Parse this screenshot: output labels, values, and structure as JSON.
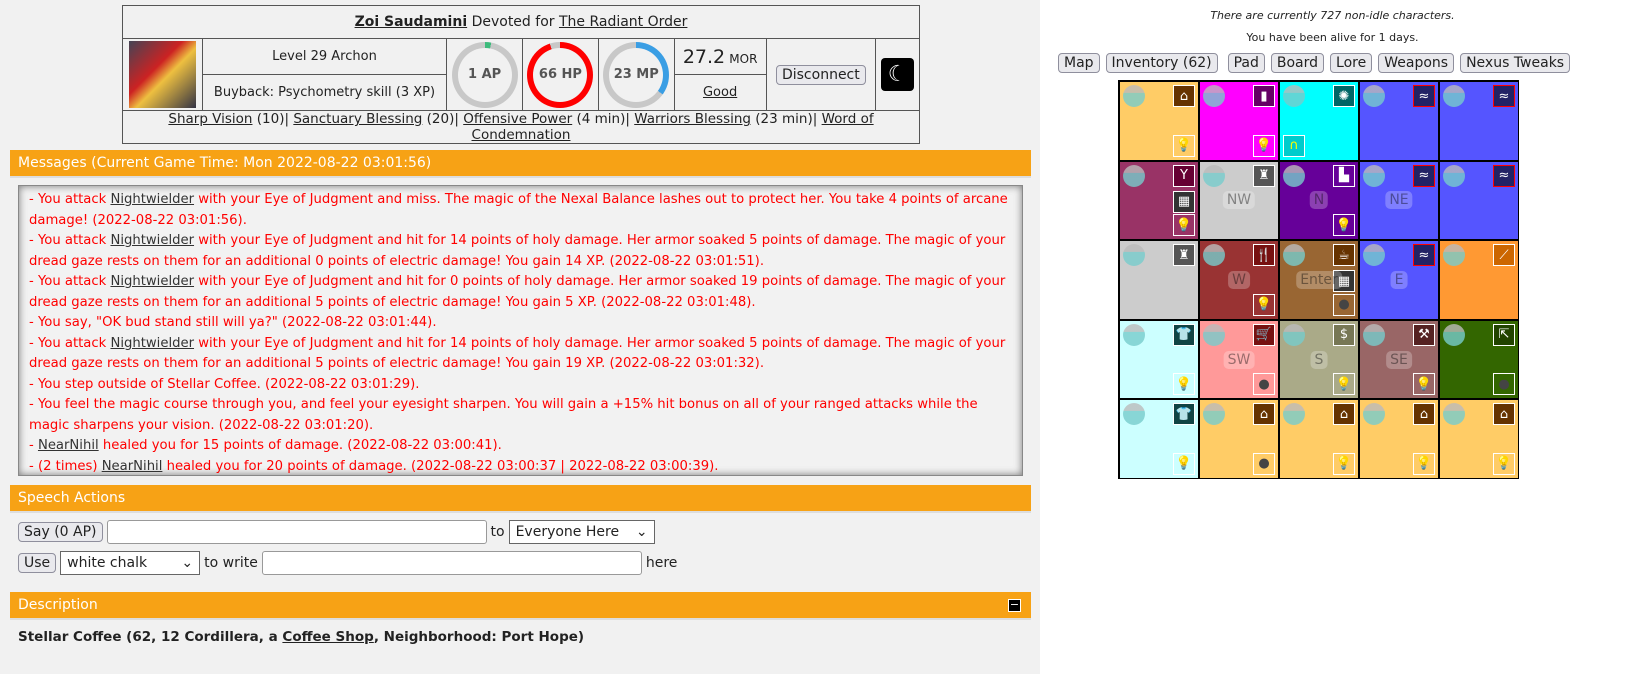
{
  "character": {
    "name": "Zoi Saudamini",
    "devoted_text": "Devoted for",
    "faction": "The Radiant Order",
    "level": "Level 29 Archon",
    "buyback": "Buyback: Psychometry skill (3 XP)",
    "ap": "1 AP",
    "ap_fraction": 0.03,
    "hp": "66 HP",
    "hp_fraction": 0.95,
    "mp": "23 MP",
    "mp_fraction": 0.35,
    "morality_value": "27.2",
    "morality_unit": "MOR",
    "alignment": "Good",
    "disconnect": "Disconnect",
    "colors": {
      "ap": "#3dbb7c",
      "hp": "#ff0000",
      "mp": "#3a9ee4",
      "ring_bg": "#c8c8c8"
    }
  },
  "effects": [
    {
      "name": "Sharp Vision",
      "detail": " (10)"
    },
    {
      "name": "Sanctuary Blessing",
      "detail": " (20)"
    },
    {
      "name": "Offensive Power",
      "detail": " (4 min)"
    },
    {
      "name": "Warriors Blessing",
      "detail": " (23 min)"
    },
    {
      "name": "Word of Condemnation",
      "detail": ""
    }
  ],
  "messages_header": "Messages (Current Game Time: Mon 2022-08-22 03:01:56)",
  "messages": [
    {
      "pre": "- You attack ",
      "link": "Nightwielder",
      "text": " with your Eye of Judgment and miss. The magic of the Nexal Balance lashes out to protect her. You take 4 points of arcane damage! (2022-08-22 03:01:56)."
    },
    {
      "pre": "- You attack ",
      "link": "Nightwielder",
      "text": " with your Eye of Judgment and hit for 14 points of holy damage. Her armor soaked 5 points of damage. The magic of your dread gaze rests on them for an additional 0 points of electric damage! You gain 14 XP. (2022-08-22 03:01:51)."
    },
    {
      "pre": "- You attack ",
      "link": "Nightwielder",
      "text": " with your Eye of Judgment and hit for 0 points of holy damage. Her armor soaked 19 points of damage. The magic of your dread gaze rests on them for an additional 5 points of electric damage! You gain 5 XP. (2022-08-22 03:01:48)."
    },
    {
      "pre": "- You say, \"OK bud stand still will ya?\" (2022-08-22 03:01:44).",
      "link": "",
      "text": ""
    },
    {
      "pre": "- You attack ",
      "link": "Nightwielder",
      "text": " with your Eye of Judgment and hit for 14 points of holy damage. Her armor soaked 5 points of damage. The magic of your dread gaze rests on them for an additional 5 points of electric damage! You gain 19 XP. (2022-08-22 03:01:32)."
    },
    {
      "pre": "- You step outside of Stellar Coffee. (2022-08-22 03:01:29).",
      "link": "",
      "text": ""
    },
    {
      "pre": "- You feel the magic course through you, and feel your eyesight sharpen. You will gain a +15% hit bonus on all of your ranged attacks while the magic sharpens your vision. (2022-08-22 03:01:20).",
      "link": "",
      "text": ""
    },
    {
      "pre": "- ",
      "link": "NearNihil",
      "text": " healed you for 15 points of damage. (2022-08-22 03:00:41)."
    },
    {
      "pre": "- (2 times) ",
      "link": "NearNihil",
      "text": " healed you for 20 points of damage. (2022-08-22 03:00:37 | 2022-08-22 03:00:39)."
    }
  ],
  "speech": {
    "header": "Speech Actions",
    "say_button": "Say (0 AP)",
    "say_value": "",
    "to": "to",
    "target": "Everyone Here",
    "use_button": "Use",
    "item": "white chalk",
    "to_write": "to write",
    "write_value": "",
    "here": "here"
  },
  "description": {
    "header": "Description",
    "collapse_icon": "minus-icon",
    "location": "Stellar Coffee (62, 12 Cordillera, a ",
    "type_link": "Coffee Shop",
    "neighborhood": ", Neighborhood: Port Hope)"
  },
  "info": {
    "online": "There are currently 727 non-idle characters.",
    "alive": "You have been alive for 1 days."
  },
  "nav": [
    "Map",
    "Inventory (62)",
    "Pad",
    "Board",
    "Lore",
    "Weapons",
    "Nexus Tweaks"
  ],
  "map": [
    [
      {
        "c": "#ffcc66",
        "icons": [
          "house-icon",
          "lightbulb-icon"
        ]
      },
      {
        "c": "#ff00ff",
        "icons": [
          "vial-icon",
          "lightbulb-icon"
        ]
      },
      {
        "c": "#00ffff",
        "icons": [
          "fireworks-icon",
          "portal-icon"
        ]
      },
      {
        "c": "#5555ff",
        "icons": [
          "water-icon"
        ]
      },
      {
        "c": "#5555ff",
        "icons": [
          "water-icon"
        ]
      }
    ],
    [
      {
        "c": "#993366",
        "icons": [
          "cocktail-icon",
          "fort-icon",
          "lightbulb-icon"
        ]
      },
      {
        "c": "#cccccc",
        "dir": "NW",
        "icons": [
          "monument-icon"
        ]
      },
      {
        "c": "#660099",
        "dir": "N",
        "icons": [
          "factory-icon",
          "lightbulb-icon"
        ]
      },
      {
        "c": "#5555ff",
        "dir": "NE",
        "icons": [
          "water-icon"
        ]
      },
      {
        "c": "#5555ff",
        "icons": [
          "water-icon"
        ]
      }
    ],
    [
      {
        "c": "#cccccc",
        "icons": [
          "monument-icon"
        ]
      },
      {
        "c": "#993333",
        "dir": "W",
        "icons": [
          "restaurant-icon",
          "lightbulb-icon"
        ]
      },
      {
        "c": "#996633",
        "dir": "Enter",
        "icons": [
          "coffee-icon",
          "fort-icon",
          "lightbulb-off-icon"
        ]
      },
      {
        "c": "#5555ff",
        "dir": "E",
        "icons": [
          "water-icon"
        ]
      },
      {
        "c": "#ff9933",
        "icons": [
          "stairs-icon"
        ]
      }
    ],
    [
      {
        "c": "#ccffff",
        "icons": [
          "shirt-icon",
          "lightbulb-icon"
        ]
      },
      {
        "c": "#ff9999",
        "dir": "SW",
        "icons": [
          "cart-icon",
          "lightbulb-off-icon"
        ]
      },
      {
        "c": "#aaaa88",
        "dir": "S",
        "icons": [
          "moneybag-icon",
          "lightbulb-icon"
        ]
      },
      {
        "c": "#996666",
        "dir": "SE",
        "icons": [
          "tools-icon",
          "lightbulb-icon"
        ]
      },
      {
        "c": "#336600",
        "icons": [
          "exit-icon",
          "lightbulb-off-icon"
        ]
      }
    ],
    [
      {
        "c": "#ccffff",
        "icons": [
          "shirt-icon",
          "lightbulb-icon"
        ]
      },
      {
        "c": "#ffcc66",
        "icons": [
          "house-icon",
          "lightbulb-off-icon"
        ]
      },
      {
        "c": "#ffcc66",
        "icons": [
          "house-icon",
          "lightbulb-icon"
        ]
      },
      {
        "c": "#ffcc66",
        "icons": [
          "house-icon",
          "lightbulb-icon"
        ]
      },
      {
        "c": "#ffcc66",
        "icons": [
          "house-icon",
          "lightbulb-icon"
        ]
      }
    ]
  ]
}
